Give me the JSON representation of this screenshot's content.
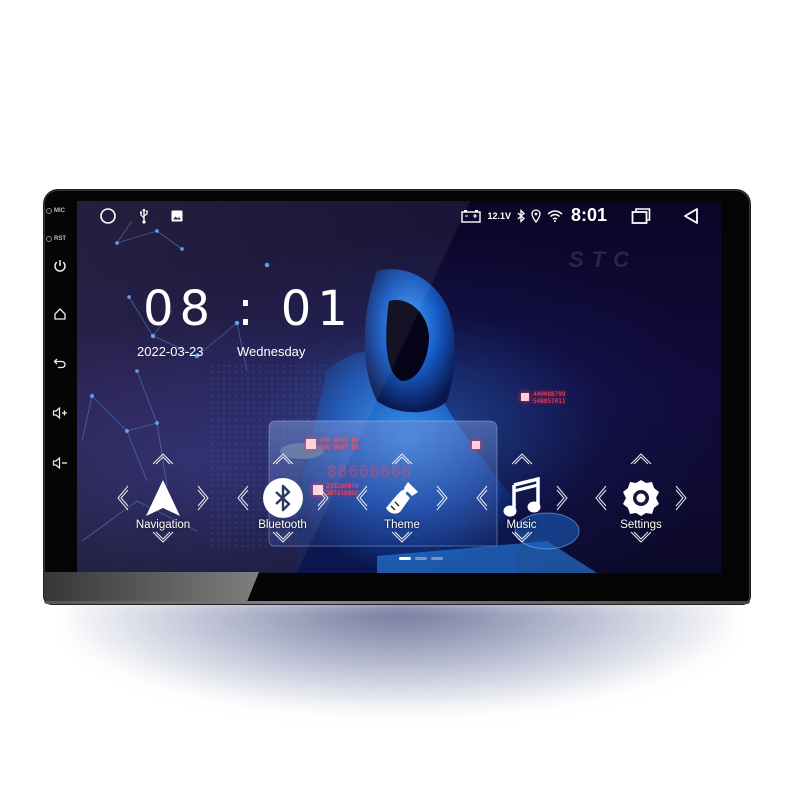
{
  "device": {
    "side_labels": {
      "mic": "MIC",
      "rst": "RST"
    },
    "side_buttons": [
      {
        "name": "power",
        "icon": "power-icon"
      },
      {
        "name": "home",
        "icon": "home-icon"
      },
      {
        "name": "back",
        "icon": "back-arrow-icon"
      },
      {
        "name": "volume-up",
        "icon": "volume-up-icon"
      },
      {
        "name": "volume-down",
        "icon": "volume-down-icon"
      }
    ]
  },
  "statusbar": {
    "left_icons": [
      "circle-home-icon",
      "usb-icon",
      "image-icon"
    ],
    "battery_icon": "car-battery-icon",
    "voltage": "12.1V",
    "bluetooth_icon": "bluetooth-icon",
    "location_icon": "location-pin-icon",
    "wifi_icon": "wifi-icon",
    "time": "8:01",
    "recents_icon": "recent-apps-icon",
    "back_icon": "back-triangle-icon"
  },
  "clock": {
    "hours": "08",
    "separator": ":",
    "minutes": "01",
    "time_display": "08 : 01",
    "date": "2022-03-23",
    "weekday": "Wednesday"
  },
  "watermark": "STC",
  "wallpaper": {
    "red_text_1": "440088799\n548857011",
    "red_text_2": "208 4098 80\n488 0867 68",
    "red_text_3": "88668866",
    "red_text_4": "223280870\n367810802"
  },
  "apps": [
    {
      "label": "Navigation",
      "icon": "navigation-arrow-icon"
    },
    {
      "label": "Bluetooth",
      "icon": "bluetooth-icon"
    },
    {
      "label": "Theme",
      "icon": "paintbrush-icon"
    },
    {
      "label": "Music",
      "icon": "music-note-icon"
    },
    {
      "label": "Settings",
      "icon": "gear-icon"
    }
  ],
  "pager": {
    "pages": 3,
    "current": 1
  }
}
